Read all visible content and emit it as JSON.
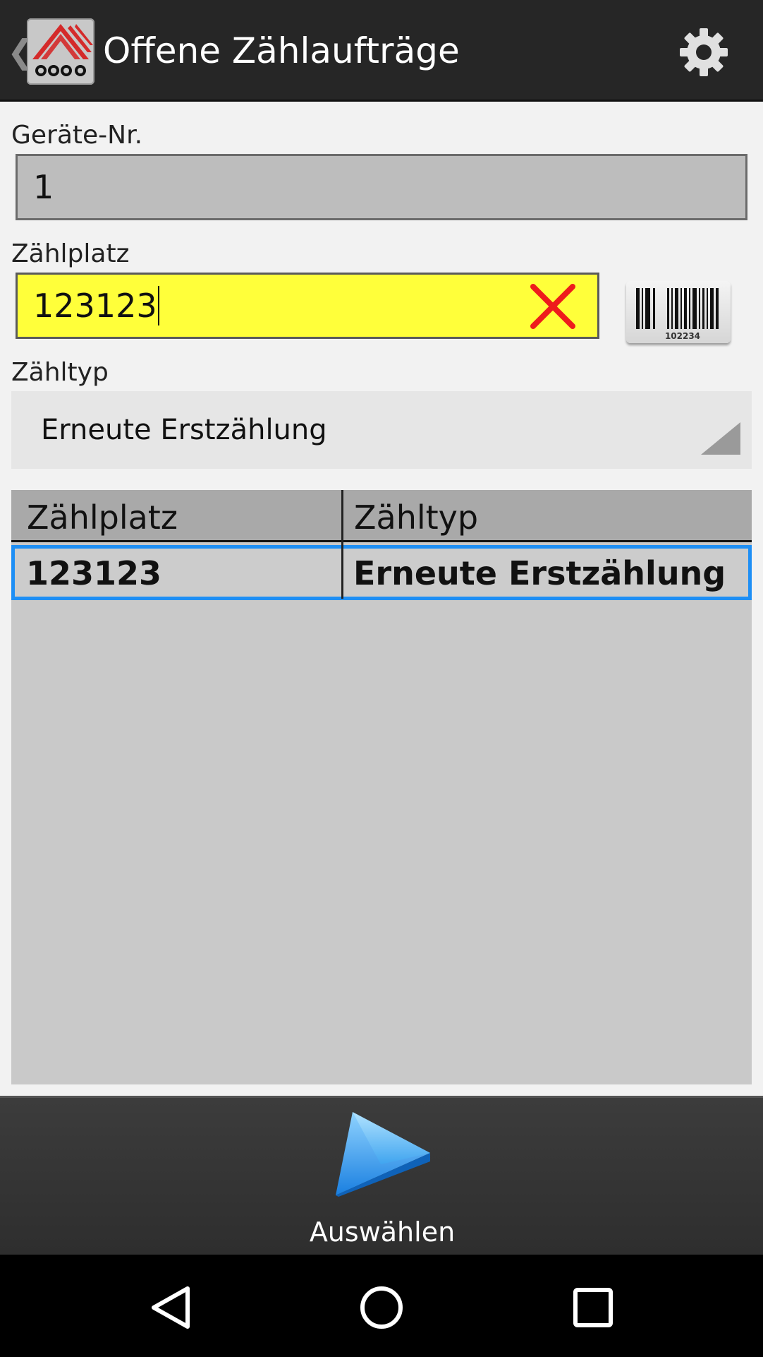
{
  "action_bar": {
    "title": "Offene Zählaufträge",
    "back_glyph": "❮",
    "logo_icon": "cosys-logo-icon",
    "settings_icon": "gear-icon"
  },
  "form": {
    "geraete_label": "Geräte-Nr.",
    "geraete_value": "1",
    "zaehlplatz_label": "Zählplatz",
    "zaehlplatz_value": "123123",
    "zaehlplatz_bg": "#ffff3a",
    "clear_icon": "clear-x-icon",
    "clear_color": "#ee1c1c",
    "barcode_icon": "barcode-icon",
    "barcode_number": "102234",
    "zaehltyp_label": "Zähltyp",
    "zaehltyp_value": "Erneute Erstzählung"
  },
  "table": {
    "columns": [
      "Zählplatz",
      "Zähltyp"
    ],
    "rows": [
      {
        "zaehlplatz": "123123",
        "zaehltyp": "Erneute Erstzählung",
        "selected": true
      }
    ],
    "selection_color": "#1e8ff5"
  },
  "bottom_bar": {
    "select_label": "Auswählen",
    "select_icon": "play-arrow-icon"
  },
  "system_nav": {
    "back_icon": "nav-back-icon",
    "home_icon": "nav-home-icon",
    "recents_icon": "nav-recents-icon"
  }
}
